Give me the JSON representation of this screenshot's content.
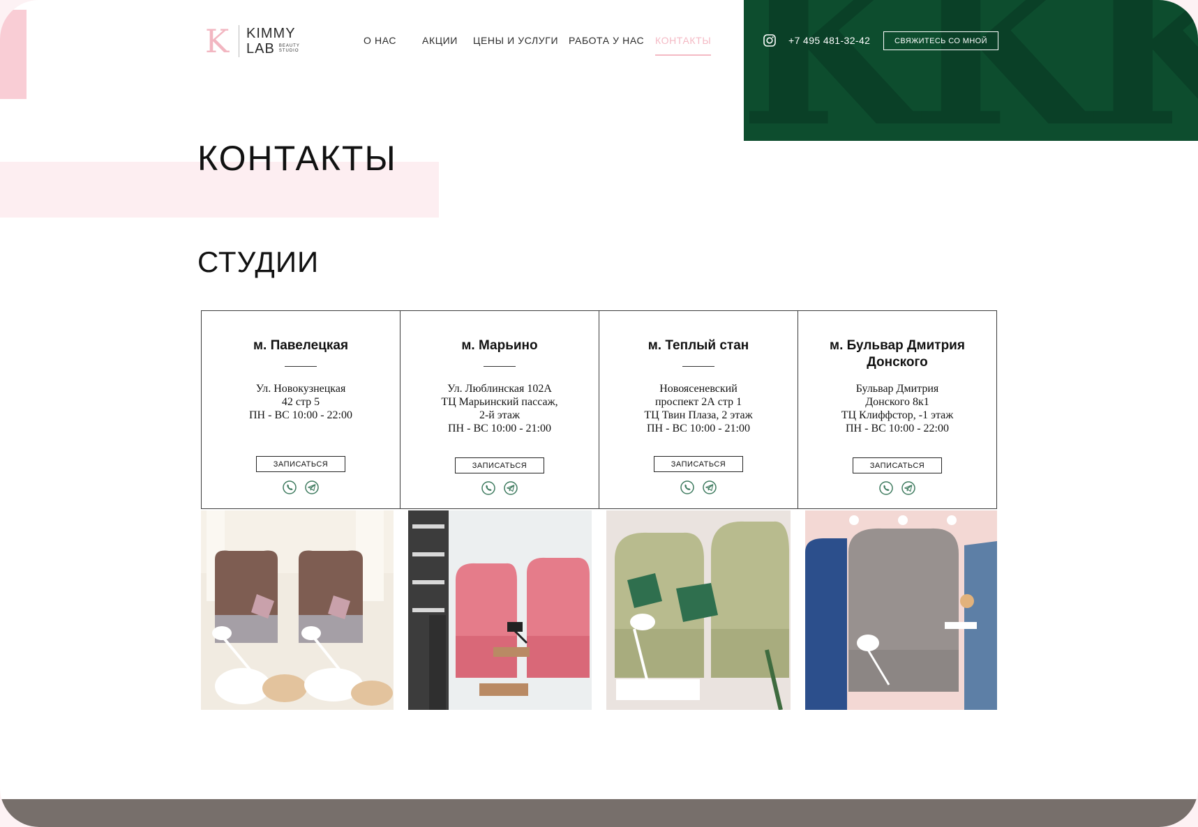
{
  "logo": {
    "mark": "K",
    "line1": "KIMMY",
    "line2": "LAB",
    "line3": "BEAUTY STUDIO"
  },
  "nav": [
    {
      "label": "О НАС"
    },
    {
      "label": "АКЦИИ"
    },
    {
      "label": "ЦЕНЫ И УСЛУГИ"
    },
    {
      "label": "РАБОТА У НАС"
    },
    {
      "label": "КОНТАКТЫ",
      "active": true
    }
  ],
  "header": {
    "phone": "+7 495 481-32-42",
    "contact_button": "СВЯЖИТЕСЬ СО МНОЙ",
    "instagram_icon": "instagram-icon"
  },
  "page": {
    "title": "КОНТАКТЫ",
    "section_title": "СТУДИИ"
  },
  "studios": [
    {
      "metro": [
        "м. Павелецкая"
      ],
      "address": [
        "Ул. Новокузнецкая",
        "42 стр 5",
        "ПН - ВС 10:00 - 22:00"
      ],
      "button": "ЗАПИСАТЬСЯ"
    },
    {
      "metro": [
        "м. Марьино"
      ],
      "address": [
        "Ул. Люблинская 102А",
        "ТЦ Марьинский пассаж,",
        "2-й этаж",
        "ПН - ВС 10:00 - 21:00"
      ],
      "button": "ЗАПИСАТЬСЯ"
    },
    {
      "metro": [
        "м. Теплый стан"
      ],
      "address": [
        "Новоясеневский",
        "проспект 2А стр 1",
        "ТЦ Твин Плаза, 2 этаж",
        "ПН - ВС 10:00 - 21:00"
      ],
      "button": "ЗАПИСАТЬСЯ"
    },
    {
      "metro": [
        "м. Бульвар Дмитрия",
        "Донского"
      ],
      "address": [
        "Бульвар Дмитрия",
        "Донского 8к1",
        "ТЦ Клиффстор, -1 этаж",
        "ПН - ВС 10:00 - 22:00"
      ],
      "button": "ЗАПИСАТЬСЯ"
    }
  ],
  "colors": {
    "accent_pink": "#f4b9c4",
    "brand_green": "#0d4d2e",
    "footer_gray": "#776f6b",
    "messenger_green": "#3d7a5e"
  }
}
